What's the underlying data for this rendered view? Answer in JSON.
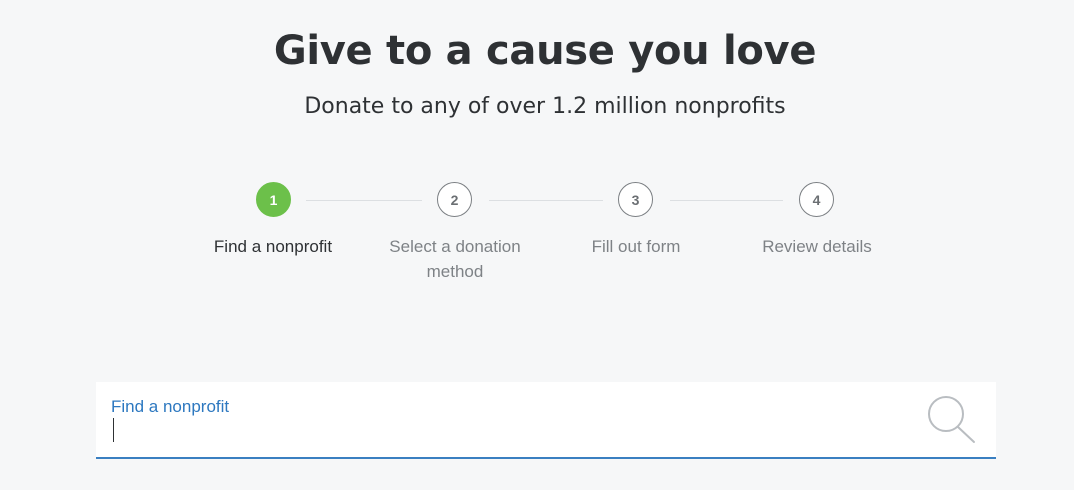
{
  "hero": {
    "title": "Give to a cause you love",
    "subtitle": "Donate to any of over 1.2 million nonprofits"
  },
  "steps": [
    {
      "number": "1",
      "label": "Find a nonprofit",
      "active": true
    },
    {
      "number": "2",
      "label": "Select a donation method",
      "active": false
    },
    {
      "number": "3",
      "label": "Fill out form",
      "active": false
    },
    {
      "number": "4",
      "label": "Review details",
      "active": false
    }
  ],
  "search": {
    "label": "Find a nonprofit",
    "value": "",
    "placeholder": "",
    "icon": "search-icon"
  },
  "colors": {
    "accent": "#3a7fc1",
    "active_step": "#6cc04a",
    "label_blue": "#2d78c0",
    "background": "#f6f7f8"
  }
}
